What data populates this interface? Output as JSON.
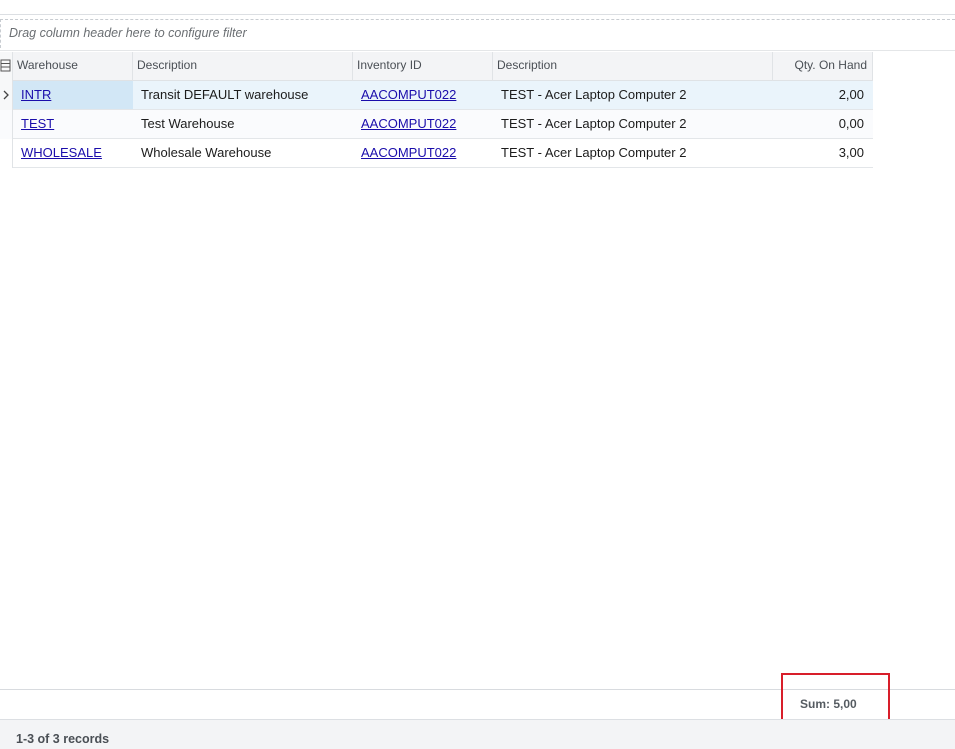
{
  "group_bar": {
    "placeholder": "Drag column header here to configure filter"
  },
  "columns": [
    "Warehouse",
    "Description",
    "Inventory ID",
    "Description",
    "Qty. On Hand"
  ],
  "rows": [
    {
      "warehouse": "INTR",
      "description": "Transit DEFAULT warehouse",
      "inventory_id": "AACOMPUT022",
      "item_description": "TEST - Acer Laptop Computer 2",
      "qty": "2,00"
    },
    {
      "warehouse": "TEST",
      "description": "Test Warehouse",
      "inventory_id": "AACOMPUT022",
      "item_description": "TEST - Acer Laptop Computer 2",
      "qty": "0,00"
    },
    {
      "warehouse": "WHOLESALE",
      "description": "Wholesale Warehouse",
      "inventory_id": "AACOMPUT022",
      "item_description": "TEST - Acer Laptop Computer 2",
      "qty": "3,00"
    }
  ],
  "footer": {
    "sum": "Sum: 5,00"
  },
  "status": {
    "records": "1-3 of 3 records"
  },
  "colors": {
    "highlight": "#d81e2a",
    "link": "#1a0dab",
    "selected_row": "#eaf4fb"
  }
}
